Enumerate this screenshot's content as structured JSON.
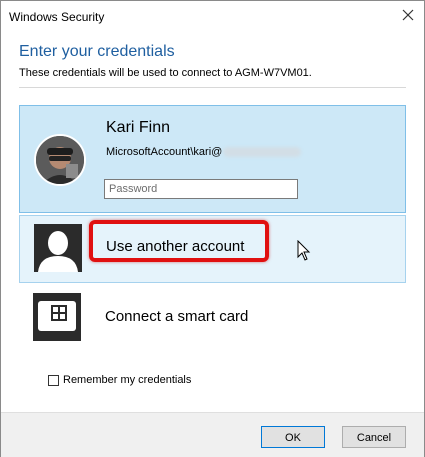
{
  "window": {
    "title": "Windows Security"
  },
  "header": {
    "heading": "Enter your credentials",
    "subtext": "These credentials will be used to connect to AGM-W7VM01."
  },
  "selected_account": {
    "name": "Kari Finn",
    "account_prefix": "MicrosoftAccount\\kari@",
    "password_placeholder": "Password",
    "password_value": ""
  },
  "other_account": {
    "label": "Use another account"
  },
  "smart_card": {
    "label": "Connect a smart card"
  },
  "remember": {
    "label": "Remember my credentials",
    "checked": false
  },
  "buttons": {
    "ok": "OK",
    "cancel": "Cancel"
  },
  "colors": {
    "accent": "#1f5fa0",
    "selected_tile": "#cde8f7",
    "hover_tile": "#e5f3fb",
    "highlight": "#e01010"
  },
  "icons": [
    "close-icon",
    "user-avatar",
    "generic-user-icon",
    "smart-card-icon",
    "mouse-cursor-icon"
  ]
}
